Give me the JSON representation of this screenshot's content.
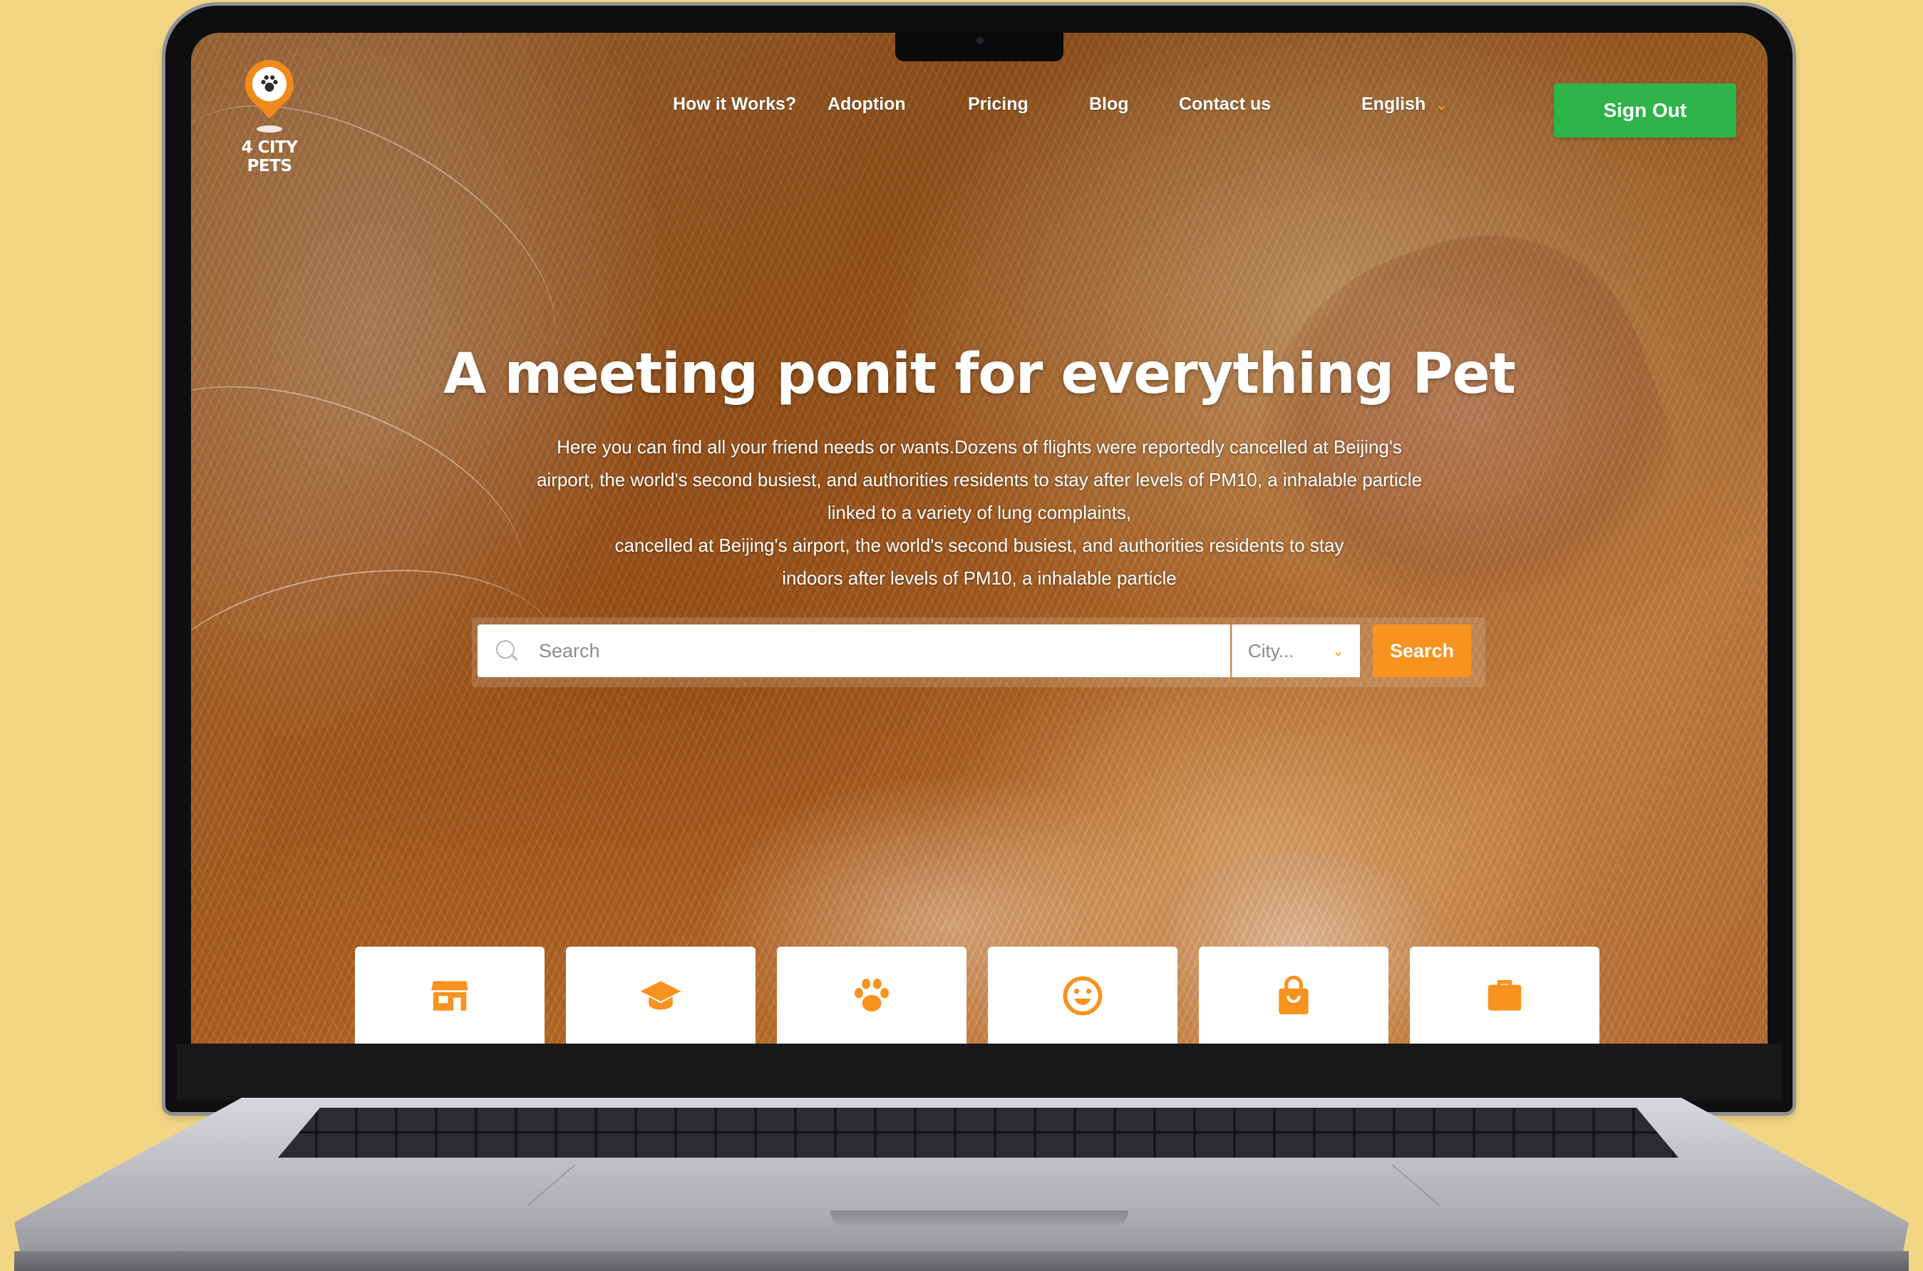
{
  "brand": {
    "name": "4 CITY PETS",
    "accent_color": "#f7931e",
    "signout_color": "#2db34a"
  },
  "nav": {
    "links": [
      {
        "label": "How it Works?"
      },
      {
        "label": "Adoption"
      },
      {
        "label": "Pricing"
      },
      {
        "label": "Blog"
      },
      {
        "label": "Contact us"
      }
    ],
    "language": "English",
    "sign_out_label": "Sign Out"
  },
  "hero": {
    "title": "A meeting ponit for everything Pet",
    "description_lines": [
      "Here you can find all your friend needs or wants.Dozens of flights were reportedly cancelled at Beijing's",
      "airport, the world's second busiest, and authorities residents to stay after levels of PM10, a inhalable particle",
      "linked to a variety of lung complaints,",
      "cancelled at Beijing's airport, the world's second busiest, and authorities residents to stay",
      "indoors after levels of PM10, a inhalable particle"
    ]
  },
  "search": {
    "placeholder": "Search",
    "city_placeholder": "City...",
    "button_label": "Search"
  },
  "categories": [
    {
      "icon": "store-icon"
    },
    {
      "icon": "graduation-cap-icon"
    },
    {
      "icon": "paw-icon"
    },
    {
      "icon": "smiley-icon"
    },
    {
      "icon": "shopping-bag-icon"
    },
    {
      "icon": "briefcase-icon"
    }
  ]
}
